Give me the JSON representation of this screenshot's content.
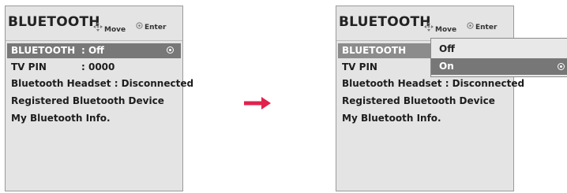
{
  "left_panel": {
    "title": "BLUETOOTH",
    "hint_move": "Move",
    "hint_enter": "Enter",
    "rows": [
      {
        "label": "BLUETOOTH",
        "value": ": Off"
      },
      {
        "label": "TV PIN",
        "value": ": 0000"
      },
      {
        "label": "Bluetooth Headset : Disconnected",
        "value": ""
      },
      {
        "label": "Registered Bluetooth Device",
        "value": ""
      },
      {
        "label": "My Bluetooth Info.",
        "value": ""
      }
    ]
  },
  "right_panel": {
    "title": "BLUETOOTH",
    "hint_move": "Move",
    "hint_enter": "Enter",
    "rows": [
      {
        "label": "BLUETOOTH",
        "value": ""
      },
      {
        "label": "TV PIN",
        "value": ""
      },
      {
        "label": "Bluetooth Headset : Disconnected",
        "value": ""
      },
      {
        "label": "Registered Bluetooth Device",
        "value": ""
      },
      {
        "label": "My Bluetooth Info.",
        "value": ""
      }
    ],
    "popup_options": [
      "Off",
      "On"
    ],
    "popup_selected": "On"
  },
  "colors": {
    "arrow": "#e2214c",
    "panel_bg": "#e4e4e4",
    "highlight": "#787878"
  },
  "icons": {
    "move": "four-way-arrow-icon",
    "enter": "ok-button-icon",
    "transition": "right-arrow-icon"
  }
}
